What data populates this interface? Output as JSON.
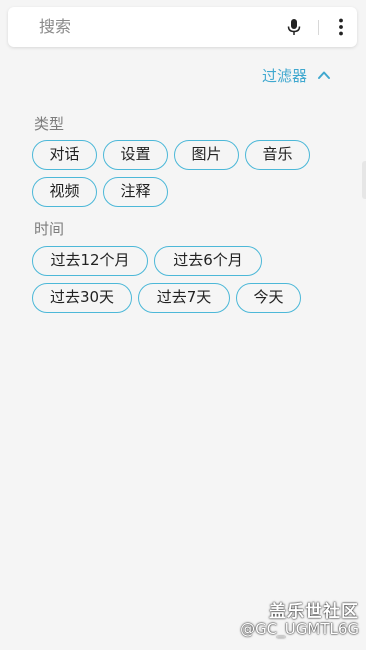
{
  "search": {
    "placeholder": "搜索"
  },
  "filter_toggle": {
    "label": "过滤器",
    "icon": "chevron-up-icon"
  },
  "type_section": {
    "title": "类型",
    "chips": [
      "对话",
      "设置",
      "图片",
      "音乐",
      "视频",
      "注释"
    ]
  },
  "time_section": {
    "title": "时间",
    "chips": [
      "过去12个月",
      "过去6个月",
      "过去30天",
      "过去7天",
      "今天"
    ]
  },
  "watermark": {
    "line1": "盖乐世社区",
    "line2": "@GC_UGMTL6G"
  },
  "colors": {
    "accent": "#3fa8cf",
    "chip_border": "#4cb8d8",
    "background": "#f5f5f5"
  },
  "icons": [
    "microphone-icon",
    "more-vert-icon",
    "chevron-up-icon"
  ]
}
